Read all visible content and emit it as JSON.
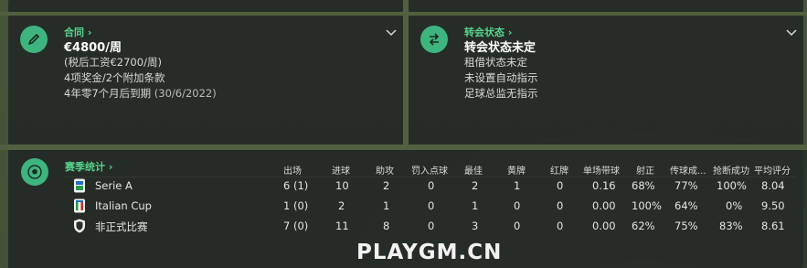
{
  "contract": {
    "link_label": "合同",
    "wage": "€4800/周",
    "after_tax": "(税后工资€2700/周)",
    "bonuses": "4项奖金/2个附加条款",
    "expiry": "4年零7个月后到期",
    "expiry_date": "(30/6/2022)"
  },
  "transfer": {
    "link_label": "转会状态",
    "title": "转会状态未定",
    "lines": [
      "租借状态未定",
      "未设置自动指示",
      "足球总监无指示"
    ]
  },
  "stats": {
    "link_label": "赛季统计",
    "headers": [
      "出场",
      "进球",
      "助攻",
      "罚入点球",
      "最佳",
      "黄牌",
      "红牌",
      "单场带球",
      "射正",
      "传球成...",
      "抢断成功",
      "平均评分"
    ],
    "rows": [
      {
        "competition": "Serie A",
        "values": [
          "6 (1)",
          "10",
          "2",
          "0",
          "2",
          "1",
          "0",
          "0.16",
          "68%",
          "77%",
          "100%",
          "8.04"
        ]
      },
      {
        "competition": "Italian Cup",
        "values": [
          "1 (0)",
          "2",
          "1",
          "0",
          "1",
          "0",
          "0",
          "0.00",
          "100%",
          "64%",
          "0%",
          "9.50"
        ]
      },
      {
        "competition": "非正式比赛",
        "values": [
          "7 (0)",
          "11",
          "8",
          "0",
          "3",
          "0",
          "0",
          "0.00",
          "62%",
          "75%",
          "83%",
          "8.61"
        ]
      }
    ]
  },
  "watermark": "PLAYGM.CN",
  "colors": {
    "accent": "#3eb47f",
    "link": "#56d58e",
    "panel": "#262c28"
  },
  "icons": {
    "contract": "pencil-icon",
    "transfer": "swap-arrows-icon",
    "stats": "football-icon"
  }
}
